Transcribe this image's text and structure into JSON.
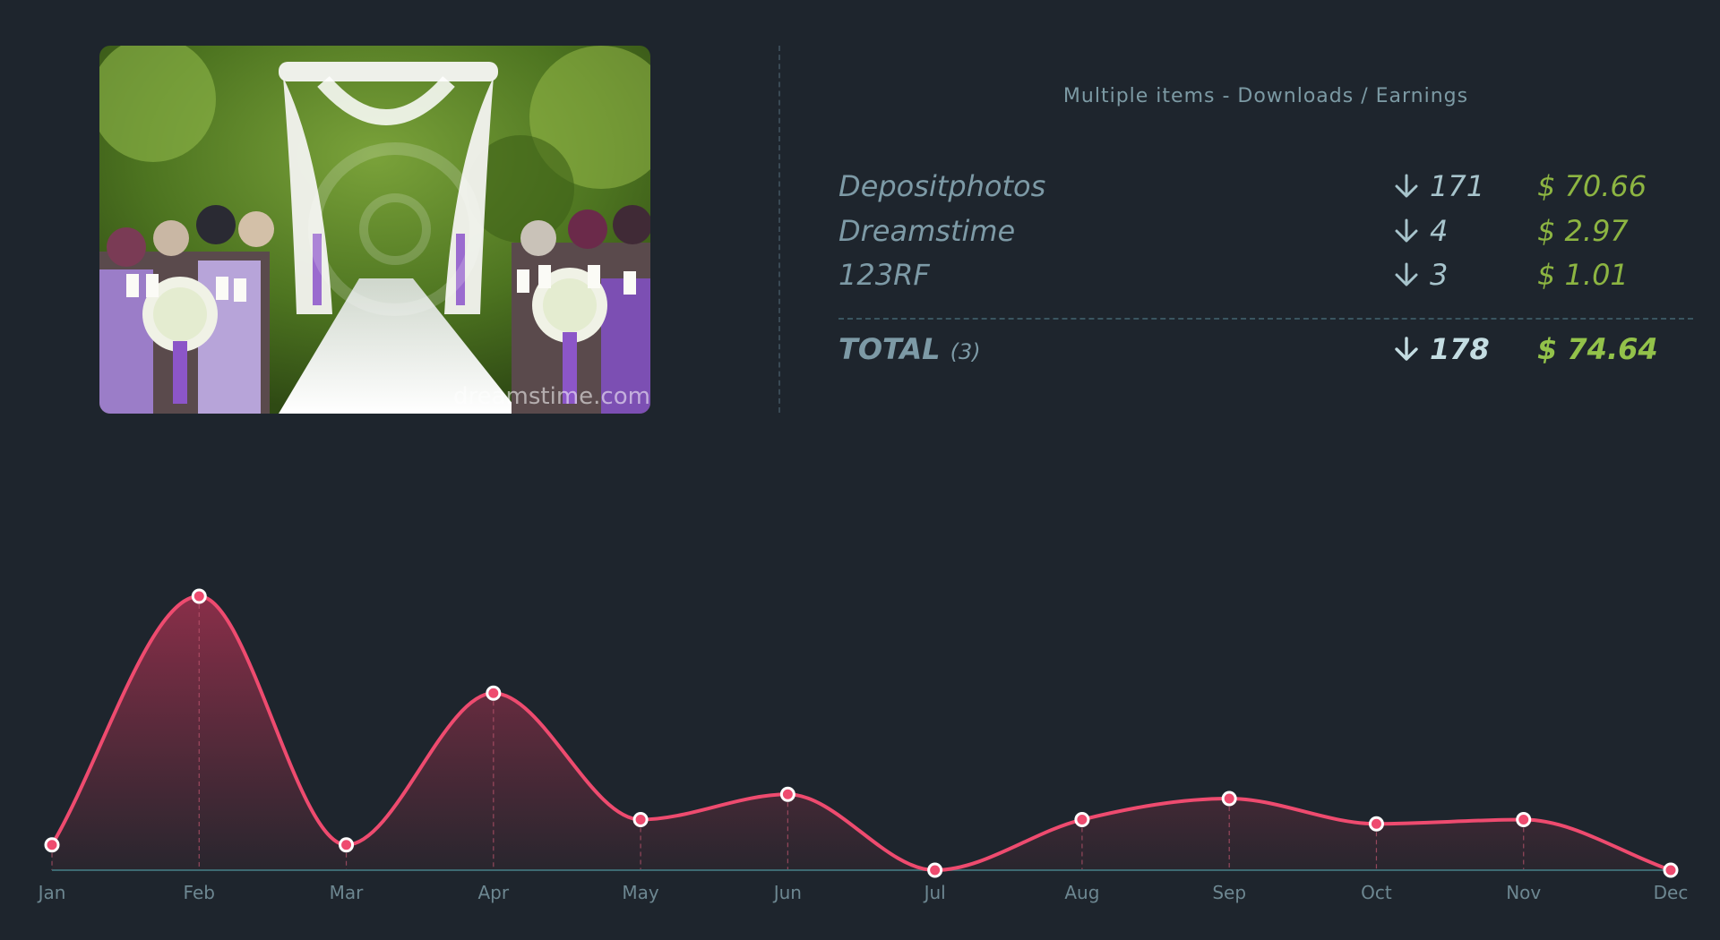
{
  "stats": {
    "title": "Multiple items - Downloads / Earnings",
    "rows": [
      {
        "name": "Depositphotos",
        "downloads": "171",
        "earnings": "$ 70.66"
      },
      {
        "name": "Dreamstime",
        "downloads": "4",
        "earnings": "$ 2.97"
      },
      {
        "name": "123RF",
        "downloads": "3",
        "earnings": "$ 1.01"
      }
    ],
    "total": {
      "label": "TOTAL",
      "count": "(3)",
      "downloads": "178",
      "earnings": "$ 74.64"
    }
  },
  "thumbnail": {
    "watermark": "dreamstime.com"
  },
  "colors": {
    "accent": "#ee4b6f",
    "earnings": "#8db542",
    "background": "#1e252d"
  },
  "icons": {
    "downloads": "arrow-down-icon"
  },
  "chart_data": {
    "type": "area",
    "categories": [
      "Jan",
      "Feb",
      "Mar",
      "Apr",
      "May",
      "Jun",
      "Jul",
      "Aug",
      "Sep",
      "Oct",
      "Nov",
      "Dec"
    ],
    "values": [
      6,
      65,
      6,
      42,
      12,
      18,
      0,
      12,
      17,
      11,
      12,
      0
    ],
    "ylim": [
      0,
      65
    ],
    "grid": false
  }
}
